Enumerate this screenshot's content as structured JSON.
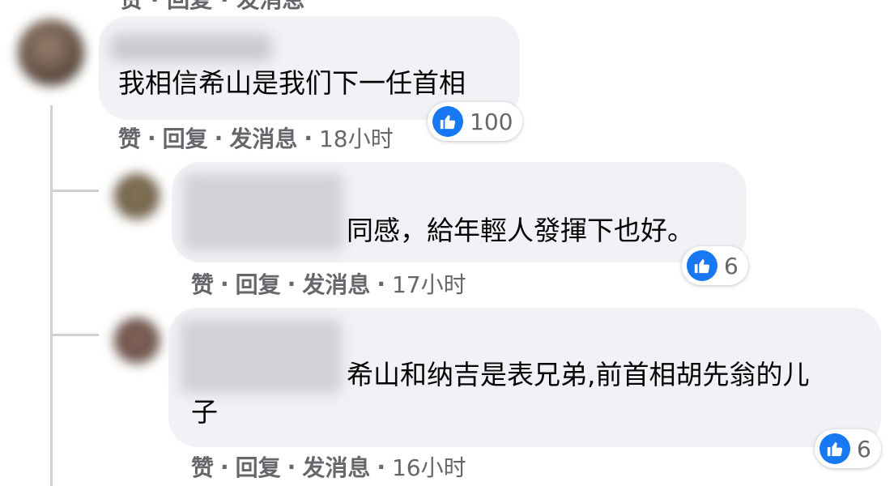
{
  "comments": [
    {
      "text": "我相信希山是我们下一任首相",
      "actions": {
        "like": "赞",
        "reply": "回复",
        "message": "发消息",
        "sep": "·",
        "time": "18小时"
      },
      "reaction_count": "100"
    },
    {
      "text": "同感，給年輕人發揮下也好。",
      "actions": {
        "like": "赞",
        "reply": "回复",
        "message": "发消息",
        "sep": "·",
        "time": "17小时"
      },
      "reaction_count": "6"
    },
    {
      "text_line1": "希山和纳吉是表兄弟,前首相胡先翁的儿",
      "text_line2": "子",
      "actions": {
        "like": "赞",
        "reply": "回复",
        "message": "发消息",
        "sep": "·",
        "time": "16小时"
      },
      "reaction_count": "6"
    }
  ],
  "colors": {
    "bubble": "#f0f2f5",
    "like_blue": "#1877f2",
    "meta_gray": "#65676b",
    "text": "#050505"
  },
  "icons": {
    "reaction": "thumbs-up-icon"
  }
}
